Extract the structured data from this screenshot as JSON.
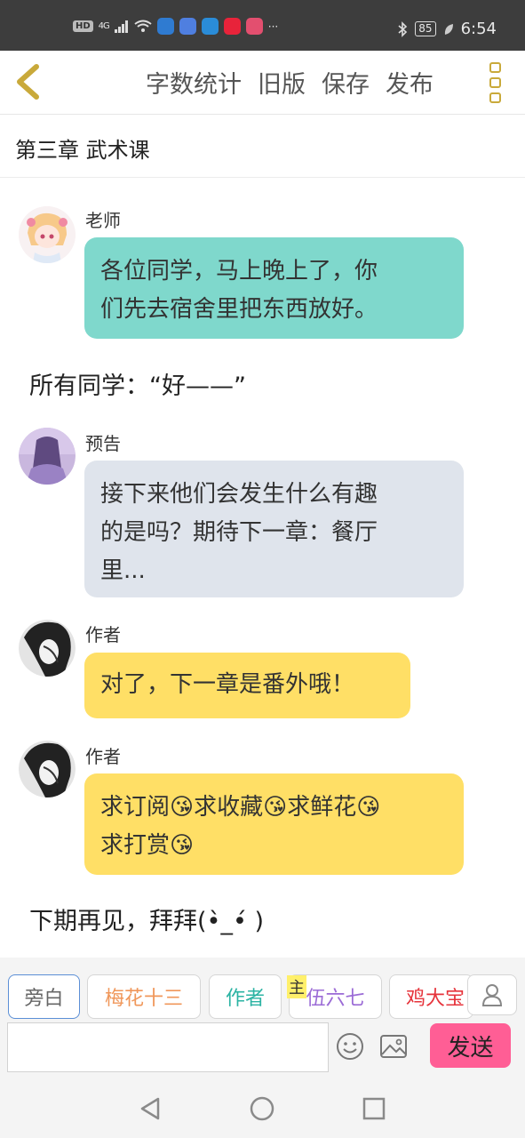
{
  "status_bar": {
    "hd": "HD",
    "network": "4G",
    "more": "···",
    "battery": "85",
    "time": "6:54",
    "app_icons": [
      "#2f7bd1",
      "#4f7fe0",
      "#2a8cd8",
      "#e8233a",
      "#e34f6f"
    ]
  },
  "toolbar": {
    "back_icon": "chevron-left-icon",
    "actions": [
      "字数统计",
      "旧版",
      "保存",
      "发布"
    ],
    "menu_icon": "three-square-dots-icon",
    "accent": "#c9a93a"
  },
  "chapter": {
    "title": "第三章 武术课"
  },
  "messages": [
    {
      "type": "bubble",
      "speaker": "老师",
      "text_lines": [
        "各位同学，马上晚上了，你",
        "们先去宿舍里把东西放好。"
      ],
      "bubble_color": "#7fd8cc"
    },
    {
      "type": "narration",
      "text": "所有同学：“好——”"
    },
    {
      "type": "bubble",
      "speaker": "预告",
      "text_lines": [
        "接下来他们会发生什么有趣",
        "的是吗？期待下一章：餐厅",
        "里..."
      ],
      "bubble_color": "#dfe4ec"
    },
    {
      "type": "bubble",
      "speaker": "作者",
      "text_lines": [
        "对了，下一章是番外哦！"
      ],
      "bubble_color": "#ffdf66"
    },
    {
      "type": "bubble",
      "speaker": "作者",
      "text_lines": [
        "求订阅😘求收藏😘求鲜花😘",
        "求打赏😘"
      ],
      "bubble_color": "#ffdf66"
    },
    {
      "type": "narration",
      "text": "下期再见，拜拜(•̀_•́ )"
    }
  ],
  "role_chips": [
    {
      "label": "旁白",
      "color": "#666666",
      "selected": true
    },
    {
      "label": "梅花十三",
      "color": "#f0975a",
      "selected": false
    },
    {
      "label": "作者",
      "color": "#2bb3a3",
      "selected": false
    },
    {
      "label": "伍六七",
      "color": "#9b6bd6",
      "selected": false
    },
    {
      "label": "鸡大宝",
      "color": "#e6333b",
      "selected": false
    }
  ],
  "host_badge": "主",
  "user_icon": "user-icon",
  "input": {
    "value": "",
    "placeholder": ""
  },
  "emoji_icon": "smiley-icon",
  "image_icon": "image-icon",
  "send_label": "发送",
  "send_color": "#ff5e95",
  "nav_icons": [
    "back-triangle-icon",
    "home-circle-icon",
    "recents-square-icon"
  ]
}
